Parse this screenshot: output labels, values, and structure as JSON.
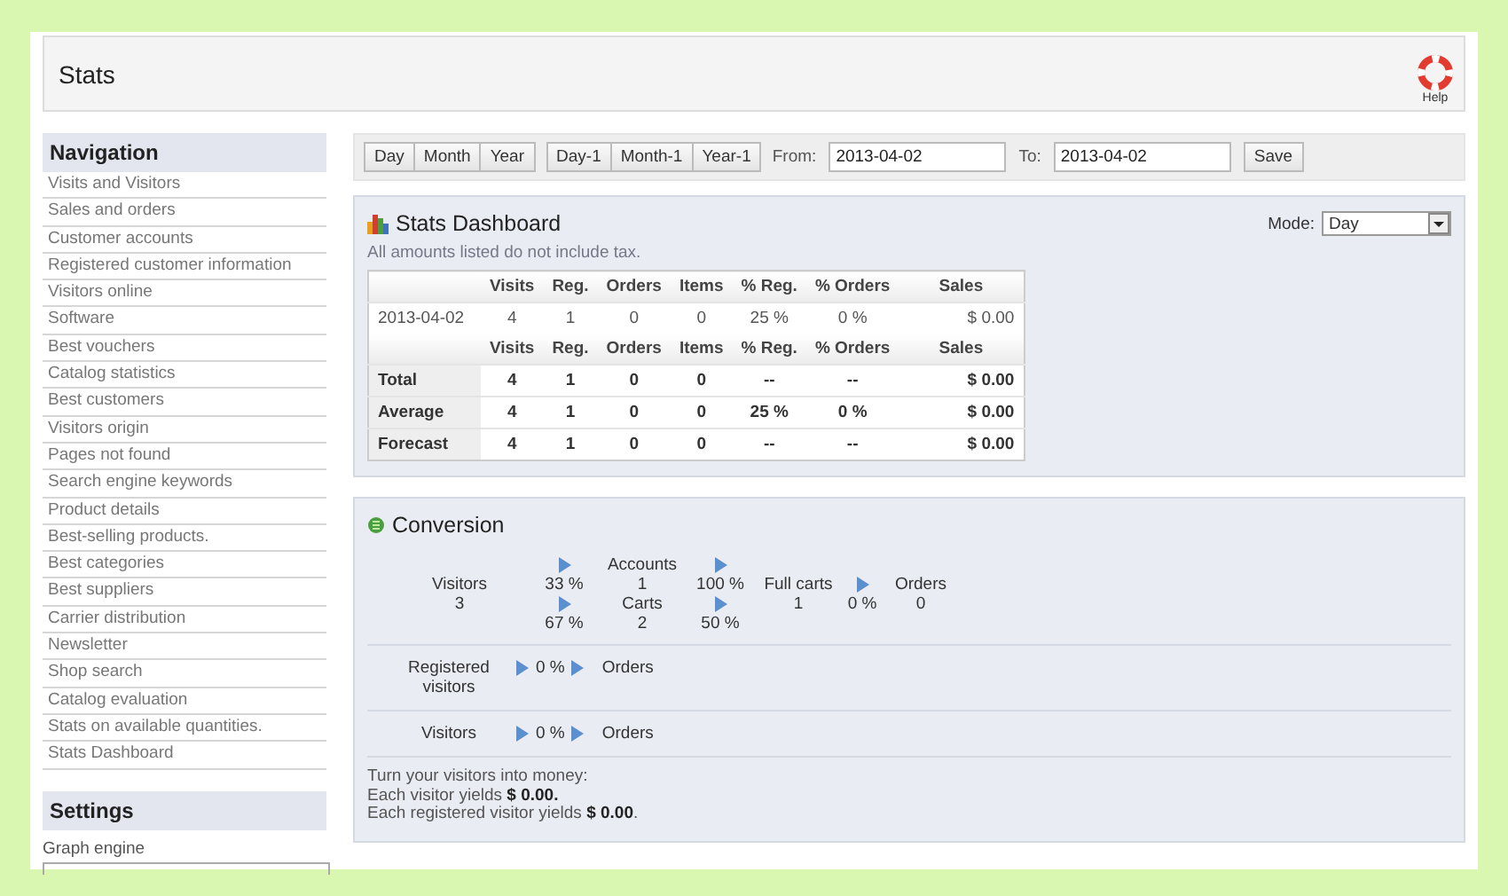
{
  "header": {
    "title": "Stats",
    "help_label": "Help"
  },
  "sidebar": {
    "navigation_title": "Navigation",
    "items": [
      {
        "label": "Visits and Visitors"
      },
      {
        "label": "Sales and orders"
      },
      {
        "label": "Customer accounts"
      },
      {
        "label": "Registered customer information"
      },
      {
        "label": "Visitors online"
      },
      {
        "label": "Software"
      },
      {
        "label": "Best vouchers"
      },
      {
        "label": "Catalog statistics"
      },
      {
        "label": "Best customers"
      },
      {
        "label": "Visitors origin"
      },
      {
        "label": "Pages not found"
      },
      {
        "label": "Search engine keywords"
      },
      {
        "label": "Product details"
      },
      {
        "label": "Best-selling products."
      },
      {
        "label": "Best categories"
      },
      {
        "label": "Best suppliers"
      },
      {
        "label": "Carrier distribution"
      },
      {
        "label": "Newsletter"
      },
      {
        "label": "Shop search"
      },
      {
        "label": "Catalog evaluation"
      },
      {
        "label": "Stats on available quantities."
      },
      {
        "label": "Stats Dashboard"
      }
    ],
    "settings_title": "Settings",
    "graph_engine_label": "Graph engine"
  },
  "toolbar": {
    "button_groups": [
      [
        "Day",
        "Month",
        "Year"
      ],
      [
        "Day-1",
        "Month-1",
        "Year-1"
      ]
    ],
    "from_label": "From:",
    "from_value": "2013-04-02",
    "to_label": "To:",
    "to_value": "2013-04-02",
    "save": "Save"
  },
  "dashboard": {
    "title": "Stats Dashboard",
    "note": "All amounts listed do not include tax.",
    "mode_label": "Mode:",
    "mode_value": "Day",
    "columns": [
      "",
      "Visits",
      "Reg.",
      "Orders",
      "Items",
      "% Reg.",
      "% Orders",
      "Sales"
    ],
    "rows": [
      [
        "2013-04-02",
        "4",
        "1",
        "0",
        "0",
        "25 %",
        "0 %",
        "$ 0.00"
      ]
    ],
    "summary_columns": [
      "",
      "Visits",
      "Reg.",
      "Orders",
      "Items",
      "% Reg.",
      "% Orders",
      "Sales"
    ],
    "summary_rows": [
      [
        "Total",
        "4",
        "1",
        "0",
        "0",
        "--",
        "--",
        "$ 0.00"
      ],
      [
        "Average",
        "4",
        "1",
        "0",
        "0",
        "25 %",
        "0 %",
        "$ 0.00"
      ],
      [
        "Forecast",
        "4",
        "1",
        "0",
        "0",
        "--",
        "--",
        "$ 0.00"
      ]
    ]
  },
  "conversion": {
    "title": "Conversion",
    "funnel": {
      "visitors_label": "Visitors",
      "visitors_value": "3",
      "to_accounts": "33 %",
      "accounts_label": "Accounts",
      "accounts_value": "1",
      "to_carts": "67 %",
      "carts_label": "Carts",
      "carts_value": "2",
      "accounts_to_full": "100 %",
      "carts_to_full": "50 %",
      "full_carts_label": "Full carts",
      "full_carts_value": "1",
      "to_orders": "0 %",
      "orders_label": "Orders",
      "orders_value": "0"
    },
    "lines": [
      {
        "label": "Registered visitors",
        "rate": "0 %",
        "target": "Orders"
      },
      {
        "label": "Visitors",
        "rate": "0 %",
        "target": "Orders"
      }
    ],
    "summary": [
      "Turn your visitors into money:",
      "Each visitor yields **$ 0.00.**",
      "Each registered visitor yields **$ 0.00**."
    ]
  }
}
